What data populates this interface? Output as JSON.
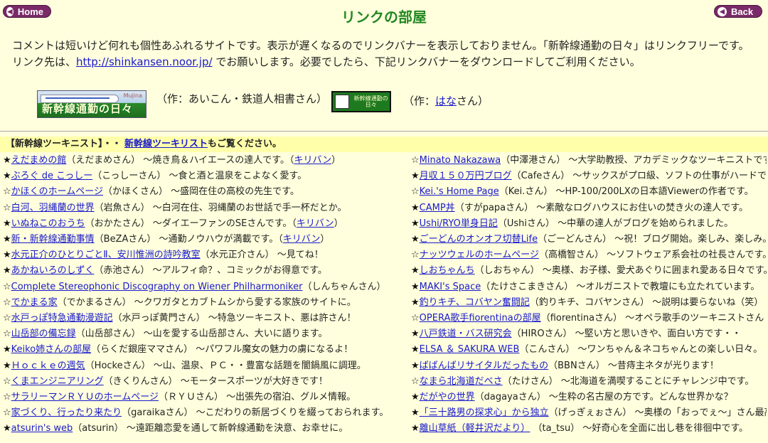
{
  "nav": {
    "home_label": "Home",
    "back_label": "Back"
  },
  "page_title": "リンクの部屋",
  "intro": {
    "line1": "コメントは短いけど何れも個性あふれるサイトです。表示が遅くなるのでリンクバナーを表示しておりません。「新幹線通勤の日々」はリンクフリーです。",
    "line2_prefix": "リンク先は、",
    "url": "http://shinkansen.noor.jp/",
    "line2_suffix": " でお願いします。必要でしたら、下記リンクバナーをダウンロードしてご利用ください。"
  },
  "banners": {
    "banner1_text": "新幹線通勤の日々",
    "banner1_mark": "Mujina",
    "credit1": "（作：あいこん・鉄道人相書さん）",
    "banner2_text": "新幹線通勤の日々",
    "credit2_prefix": "（作：",
    "credit2_link": "はな",
    "credit2_suffix": "さん）"
  },
  "section": {
    "head_prefix": "【新幹線ツーキニスト】・・ ",
    "head_link": "新幹線ツーキリスト",
    "head_suffix": "もご覧ください。"
  },
  "left_items": [
    {
      "star": "★",
      "link": "えだまめの館",
      "desc": "（えだまめさん） ～焼き鳥＆ハイエースの達人です。（",
      "link2": "キリバン",
      "tail": "）"
    },
    {
      "star": "★",
      "link": "ぶろぐ de こっしー",
      "desc": "（こっしーさん） ～食と酒と温泉をこよなく愛す。",
      "link2": "",
      "tail": ""
    },
    {
      "star": "☆",
      "link": "かほくのホームページ",
      "desc": "（かほくさん） ～盛岡在住の高校の先生です。",
      "link2": "",
      "tail": ""
    },
    {
      "star": "☆",
      "link": "白河、羽縄蘭の世界",
      "desc": "（岩魚さん） ～白河在住、羽縄蘭のお世話で手一杯だとか。",
      "link2": "",
      "tail": ""
    },
    {
      "star": "★",
      "link": "いぬねこのおうち",
      "desc": "（おかたさん） ～ダイエーファンのSEさんです。（",
      "link2": "キリバン",
      "tail": "）"
    },
    {
      "star": "★",
      "link": "新・新幹線通勤事情",
      "desc": "（BeZAさん） ～通勤ノウハウが満載です。（",
      "link2": "キリバン",
      "tail": "）"
    },
    {
      "star": "★",
      "link": "水元正介のひとりごとⅡ、安川惟洲の詩吟教室",
      "desc": "（水元正介さん） ～見てね！",
      "link2": "",
      "tail": ""
    },
    {
      "star": "★",
      "link": "あかねいろのしずく",
      "desc": "（赤池さん） ～アルフィ命？、コミックがお得意です。",
      "link2": "",
      "tail": ""
    },
    {
      "star": "☆",
      "link": "Complete Stereophonic Discography on Wiener Philharmoniker",
      "desc": "（しんちゃんさん）",
      "link2": "",
      "tail": ""
    },
    {
      "star": "☆",
      "link": "でかまる家",
      "desc": "（でかまるさん） ～クワガタとカブトムシから愛する家族のサイトに。",
      "link2": "",
      "tail": ""
    },
    {
      "star": "☆",
      "link": "水戸っぽ特急通勤漫遊記",
      "desc": "（水戸っぽ黄門さん） ～特急ツーキニスト、悪は許さん！",
      "link2": "",
      "tail": ""
    },
    {
      "star": "☆",
      "link": "山岳部の備忘録",
      "desc": "（山岳部さん） ～山を愛する山岳部さん、大いに語ります。",
      "link2": "",
      "tail": ""
    },
    {
      "star": "★",
      "link": "Keiko姉さんの部屋",
      "desc": "（らくだ銀座ママさん） ～パワフル魔女の魅力の虜になるよ！",
      "link2": "",
      "tail": ""
    },
    {
      "star": "★",
      "link": "Ｈｏｃｋｅの週気",
      "desc": "（Hockeさん） ～山、温泉、ＰＣ・・豊富な話題を闇鍋風に調理。",
      "link2": "",
      "tail": ""
    },
    {
      "star": "☆",
      "link": "くまエンジニアリング",
      "desc": "（きくりんさん） ～モータースポーツが大好きです！",
      "link2": "",
      "tail": ""
    },
    {
      "star": "☆",
      "link": "サラリーマンＲＹＵのホームページ",
      "desc": "（ＲＹＵさん） ～出張先の宿泊、グルメ情報。",
      "link2": "",
      "tail": ""
    },
    {
      "star": "☆",
      "link": "家づくり、行ったり来たり",
      "desc": "（garaikaさん） ～こだわりの新居づくりを綴っておられます。",
      "link2": "",
      "tail": ""
    },
    {
      "star": "★",
      "link": "atsurin's web",
      "desc": "（atsurin） ～遠距離恋愛を通して新幹線通勤を決意、お幸せに。",
      "link2": "",
      "tail": ""
    }
  ],
  "right_items": [
    {
      "star": "☆",
      "link": "Minato Nakazawa",
      "desc": "（中澤港さん） ～大学助教授、アカデミックなツーキニストです。"
    },
    {
      "star": "★",
      "link": "月収１５０万円ブログ",
      "desc": "（Cafeさん） ～サックスがプロ級、ソフトの仕事がハードです。"
    },
    {
      "star": "☆",
      "link": "Kei.'s Home Page",
      "desc": "（Kei.さん） ～HP-100/200LXの日本語Viewerの作者です。"
    },
    {
      "star": "★",
      "link": "CAMP丼",
      "desc": "（すがpapaさん） ～素敵なログハウスにお住いの焚き火の達人です。"
    },
    {
      "star": "★",
      "link": "Ushi/RYO単身日記",
      "desc": "（Ushiさん） ～中華の達人がブログを始められました。"
    },
    {
      "star": "★",
      "link": "ごーどんのオンオフ切替Life",
      "desc": "（ごーどんさん） ～祝！ブログ開始。楽しみ、楽しみ。"
    },
    {
      "star": "☆",
      "link": "ナッツウェルのホームページ",
      "desc": "（高橋智さん） ～ソフトウェア系会社の社長さんです。"
    },
    {
      "star": "★",
      "link": "しおちゃんち",
      "desc": "（しおちゃん） ～奥様、お子様、愛犬あぐりに囲まれ愛ある日々です。"
    },
    {
      "star": "★",
      "link": "MAKI's Space",
      "desc": "（たけさこまきさん） ～オルガニストで教壇にも立たれています。"
    },
    {
      "star": "★",
      "link": "釣りキチ、コバヤン奮闘記",
      "desc": "（釣りキチ、コバヤンさん） ～説明は要らないね（笑）"
    },
    {
      "star": "☆",
      "link": "OPERA歌手fiorentinaの部屋",
      "desc": "（fiorentinaさん） ～オペラ歌手のツーキニストさん"
    },
    {
      "star": "★",
      "link": "八戸鉄道・バス研究会",
      "desc": "（HIROさん） ～堅い方と思いきや、面白い方です・・"
    },
    {
      "star": "★",
      "link": "ELSA ＆ SAKURA WEB",
      "desc": "（こんさん） ～ワンちゃん＆ネコちゃんとの楽しい日々。"
    },
    {
      "star": "★",
      "link": "ばばんばリサイタルだったもの",
      "desc": "（BBNさん） ～昔痔主ネタが光ります！"
    },
    {
      "star": "☆",
      "link": "なまら北海道だべさ",
      "desc": "（たけさん） ～北海道を満喫することにチャレンジ中です。"
    },
    {
      "star": "★",
      "link": "だがやの世界",
      "desc": "（dagayaさん） ～生粋の名古屋の方です。どんな世界かな？"
    },
    {
      "star": "★",
      "link": "「三十路男の探求心」から独立",
      "desc": "（げっぎぇぉさん） ～奥様の「おっでぇ～」さん最高！"
    },
    {
      "star": "★",
      "link": "離山草紙（軽井沢だより）",
      "desc": " （ta_tsu） ～好奇心を全面に出し巷を徘徊中です。"
    }
  ]
}
